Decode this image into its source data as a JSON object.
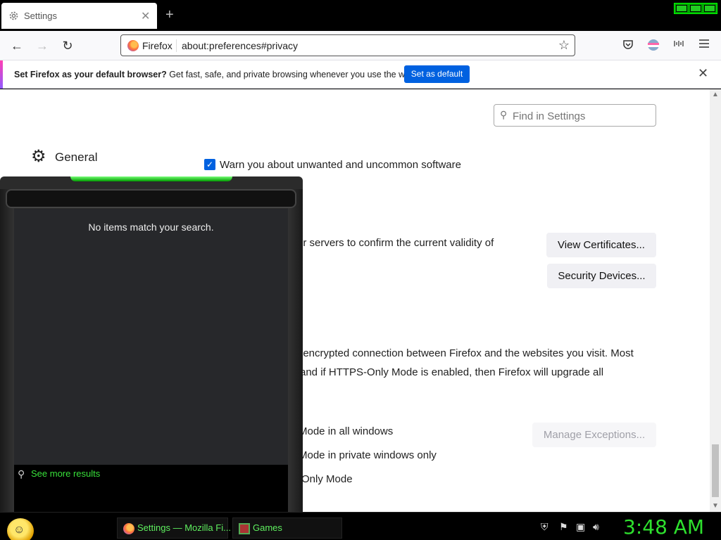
{
  "tab": {
    "title": "Settings",
    "close": "✕",
    "new_tab": "+"
  },
  "nav": {
    "back": "←",
    "forward": "→",
    "reload": "↻"
  },
  "urlbar": {
    "identity": "Firefox",
    "url": "about:preferences#privacy",
    "bookmark": "☆"
  },
  "notification": {
    "bold": "Set Firefox as your default browser?",
    "text": " Get fast, safe, and private browsing whenever you use the web.",
    "button": "Set as default",
    "close": "✕"
  },
  "settings": {
    "find_placeholder": "Find in Settings",
    "category_general": "General",
    "warn_checkbox_label": "Warn you about unwanted and uncommon software",
    "cert_text": "er servers to confirm the current validity of",
    "view_certificates": "View Certificates...",
    "security_devices": "Security Devices...",
    "https_text_1": ", encrypted connection between Firefox and the websites you visit. Most",
    "https_text_2": " and if HTTPS-Only Mode is enabled, then Firefox will upgrade all",
    "mode_all": "Mode in all windows",
    "mode_private": "Mode in private windows only",
    "mode_off": "Only Mode",
    "manage_exceptions": "Manage Exceptions..."
  },
  "launcher": {
    "no_items": "No items match your search.",
    "see_more": "See more results"
  },
  "taskbar": {
    "tasks": [
      {
        "label": "Settings — Mozilla Fi..."
      },
      {
        "label": "Games"
      }
    ],
    "clock": "3:48 AM"
  }
}
